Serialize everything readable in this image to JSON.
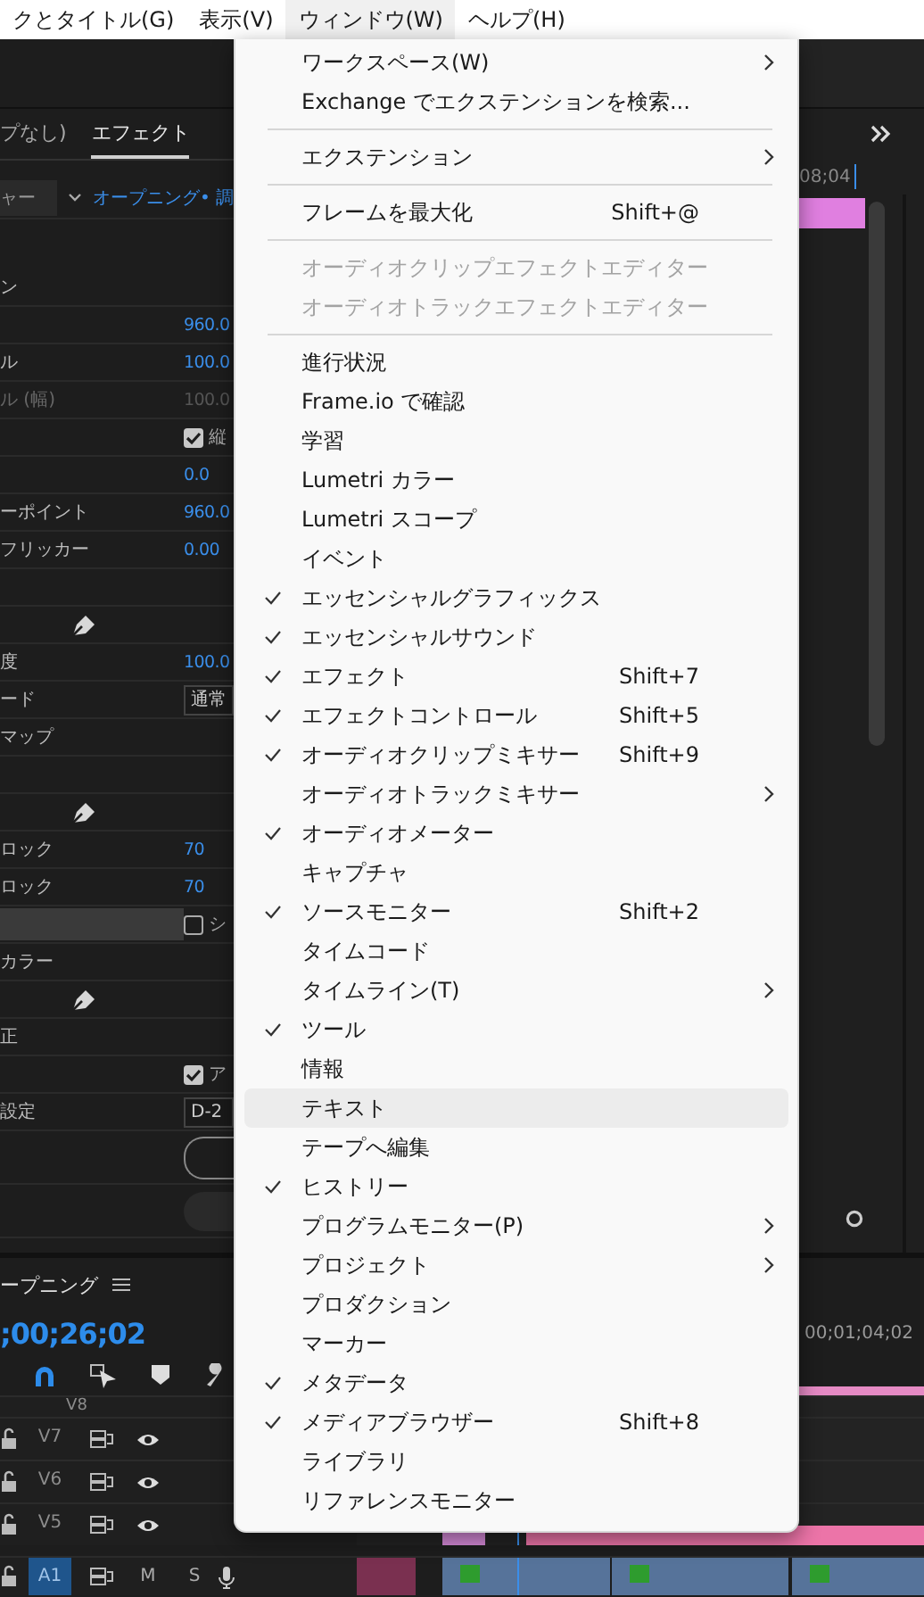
{
  "menubar": {
    "items": [
      {
        "label": "クとタイトル(G)",
        "selected": false
      },
      {
        "label": "表示(V)",
        "selected": false
      },
      {
        "label": "ウィンドウ(W)",
        "selected": true
      },
      {
        "label": "ヘルプ(H)",
        "selected": false
      }
    ]
  },
  "effect_controls": {
    "tabs": [
      {
        "label": "プなし)",
        "selected": false
      },
      {
        "label": "エフェクト",
        "selected": true
      }
    ],
    "source": "ャー",
    "clip": "オープニング• 調",
    "rows": [
      {
        "kind": "section",
        "label": "ン"
      },
      {
        "kind": "value",
        "value": "960.0",
        "disabled": false
      },
      {
        "kind": "value",
        "label": "ル",
        "value": "100.0",
        "disabled": false
      },
      {
        "kind": "value",
        "label": "ル (幅)",
        "value": "100.0",
        "disabled": true
      },
      {
        "kind": "checkbox",
        "checked": true,
        "text": "縦"
      },
      {
        "kind": "value",
        "value": "0.0",
        "disabled": false
      },
      {
        "kind": "value",
        "label": "ーポイント",
        "value": "960.0",
        "disabled": false
      },
      {
        "kind": "value",
        "label": "フリッカー",
        "value": "0.00",
        "disabled": false
      },
      {
        "kind": "blank"
      },
      {
        "kind": "pen"
      },
      {
        "kind": "value",
        "label": "度",
        "value": "100.0",
        "disabled": false
      },
      {
        "kind": "dropdown",
        "label": "ード",
        "value": "通常"
      },
      {
        "kind": "section",
        "label": "マップ"
      },
      {
        "kind": "blank"
      },
      {
        "kind": "pen"
      },
      {
        "kind": "value",
        "label": "ロック",
        "value": "70",
        "disabled": false
      },
      {
        "kind": "value",
        "label": "ロック",
        "value": "70",
        "disabled": false
      },
      {
        "kind": "bar",
        "checked": false,
        "text": "シ"
      },
      {
        "kind": "section",
        "label": "カラー"
      },
      {
        "kind": "pen"
      },
      {
        "kind": "section",
        "label": "正"
      },
      {
        "kind": "checkbox",
        "checked": true,
        "text": "ア"
      },
      {
        "kind": "dropdown",
        "label": "設定",
        "value": "D-2"
      },
      {
        "kind": "button",
        "disabled": false
      },
      {
        "kind": "button",
        "disabled": true
      }
    ]
  },
  "program_monitor": {
    "timecode": "08;04"
  },
  "timeline": {
    "title": "ープニング",
    "timecode": ";00;26;02",
    "ruler_time": "00;01;04;02",
    "tracks": [
      {
        "name": "V8",
        "kind": "video",
        "selected": false
      },
      {
        "name": "V7",
        "kind": "video",
        "selected": false
      },
      {
        "name": "V6",
        "kind": "video",
        "selected": false
      },
      {
        "name": "V5",
        "kind": "video",
        "selected": false
      },
      {
        "name": "A1",
        "kind": "audio",
        "selected": true,
        "mute": "M",
        "solo": "S"
      }
    ]
  },
  "window_menu": {
    "items": [
      {
        "kind": "item",
        "label": "ワークスペース(W)",
        "checked": false,
        "disabled": false,
        "submenu": true,
        "selected": false
      },
      {
        "kind": "item",
        "label": "Exchange でエクステンションを検索...",
        "checked": false,
        "disabled": false,
        "submenu": false,
        "selected": false
      },
      {
        "kind": "separator"
      },
      {
        "kind": "item",
        "label": "エクステンション",
        "checked": false,
        "disabled": false,
        "submenu": true,
        "selected": false
      },
      {
        "kind": "separator"
      },
      {
        "kind": "item",
        "label": "フレームを最大化",
        "shortcut": "Shift+@",
        "checked": false,
        "disabled": false,
        "submenu": false,
        "selected": false
      },
      {
        "kind": "separator"
      },
      {
        "kind": "item",
        "label": "オーディオクリップエフェクトエディター",
        "checked": false,
        "disabled": true,
        "submenu": false,
        "selected": false
      },
      {
        "kind": "item",
        "label": "オーディオトラックエフェクトエディター",
        "checked": false,
        "disabled": true,
        "submenu": false,
        "selected": false
      },
      {
        "kind": "separator"
      },
      {
        "kind": "item",
        "label": "進行状況",
        "checked": false,
        "disabled": false,
        "submenu": false,
        "selected": false
      },
      {
        "kind": "item",
        "label": "Frame.io で確認",
        "checked": false,
        "disabled": false,
        "submenu": false,
        "selected": false
      },
      {
        "kind": "item",
        "label": "学習",
        "checked": false,
        "disabled": false,
        "submenu": false,
        "selected": false
      },
      {
        "kind": "item",
        "label": "Lumetri カラー",
        "checked": false,
        "disabled": false,
        "submenu": false,
        "selected": false
      },
      {
        "kind": "item",
        "label": "Lumetri スコープ",
        "checked": false,
        "disabled": false,
        "submenu": false,
        "selected": false
      },
      {
        "kind": "item",
        "label": "イベント",
        "checked": false,
        "disabled": false,
        "submenu": false,
        "selected": false
      },
      {
        "kind": "item",
        "label": "エッセンシャルグラフィックス",
        "checked": true,
        "disabled": false,
        "submenu": false,
        "selected": false
      },
      {
        "kind": "item",
        "label": "エッセンシャルサウンド",
        "checked": true,
        "disabled": false,
        "submenu": false,
        "selected": false
      },
      {
        "kind": "item",
        "label": "エフェクト",
        "shortcut": "Shift+7",
        "checked": true,
        "disabled": false,
        "submenu": false,
        "selected": false
      },
      {
        "kind": "item",
        "label": "エフェクトコントロール",
        "shortcut": "Shift+5",
        "checked": true,
        "disabled": false,
        "submenu": false,
        "selected": false
      },
      {
        "kind": "item",
        "label": "オーディオクリップミキサー",
        "shortcut": "Shift+9",
        "checked": true,
        "disabled": false,
        "submenu": false,
        "selected": false
      },
      {
        "kind": "item",
        "label": "オーディオトラックミキサー",
        "checked": false,
        "disabled": false,
        "submenu": true,
        "selected": false
      },
      {
        "kind": "item",
        "label": "オーディオメーター",
        "checked": true,
        "disabled": false,
        "submenu": false,
        "selected": false
      },
      {
        "kind": "item",
        "label": "キャプチャ",
        "checked": false,
        "disabled": false,
        "submenu": false,
        "selected": false
      },
      {
        "kind": "item",
        "label": "ソースモニター",
        "shortcut": "Shift+2",
        "checked": true,
        "disabled": false,
        "submenu": false,
        "selected": false
      },
      {
        "kind": "item",
        "label": "タイムコード",
        "checked": false,
        "disabled": false,
        "submenu": false,
        "selected": false
      },
      {
        "kind": "item",
        "label": "タイムライン(T)",
        "checked": false,
        "disabled": false,
        "submenu": true,
        "selected": false
      },
      {
        "kind": "item",
        "label": "ツール",
        "checked": true,
        "disabled": false,
        "submenu": false,
        "selected": false
      },
      {
        "kind": "item",
        "label": "情報",
        "checked": false,
        "disabled": false,
        "submenu": false,
        "selected": false
      },
      {
        "kind": "item",
        "label": "テキスト",
        "checked": false,
        "disabled": false,
        "submenu": false,
        "selected": true
      },
      {
        "kind": "item",
        "label": "テープへ編集",
        "checked": false,
        "disabled": false,
        "submenu": false,
        "selected": false
      },
      {
        "kind": "item",
        "label": "ヒストリー",
        "checked": true,
        "disabled": false,
        "submenu": false,
        "selected": false
      },
      {
        "kind": "item",
        "label": "プログラムモニター(P)",
        "checked": false,
        "disabled": false,
        "submenu": true,
        "selected": false
      },
      {
        "kind": "item",
        "label": "プロジェクト",
        "checked": false,
        "disabled": false,
        "submenu": true,
        "selected": false
      },
      {
        "kind": "item",
        "label": "プロダクション",
        "checked": false,
        "disabled": false,
        "submenu": false,
        "selected": false
      },
      {
        "kind": "item",
        "label": "マーカー",
        "checked": false,
        "disabled": false,
        "submenu": false,
        "selected": false
      },
      {
        "kind": "item",
        "label": "メタデータ",
        "checked": true,
        "disabled": false,
        "submenu": false,
        "selected": false
      },
      {
        "kind": "item",
        "label": "メディアブラウザー",
        "shortcut": "Shift+8",
        "checked": true,
        "disabled": false,
        "submenu": false,
        "selected": false
      },
      {
        "kind": "item",
        "label": "ライブラリ",
        "checked": false,
        "disabled": false,
        "submenu": false,
        "selected": false
      },
      {
        "kind": "item",
        "label": "リファレンスモニター",
        "checked": false,
        "disabled": false,
        "submenu": false,
        "selected": false
      }
    ]
  }
}
